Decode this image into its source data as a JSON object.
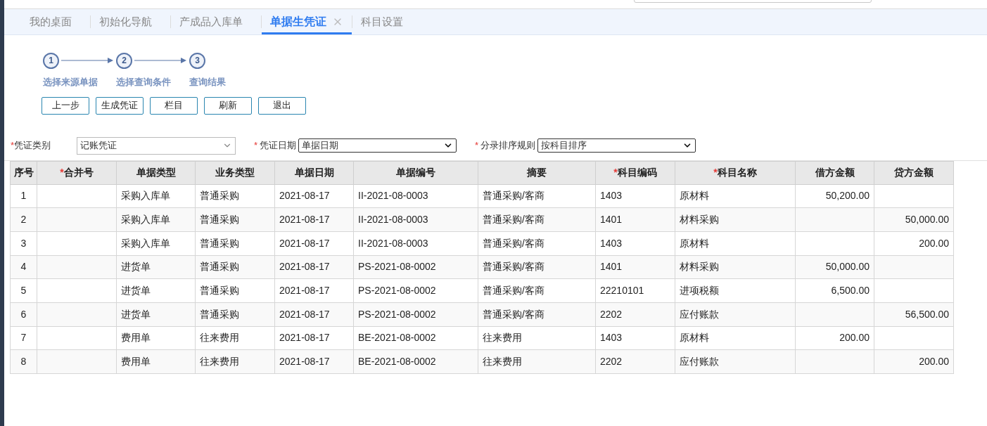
{
  "tabs": [
    {
      "label": "我的桌面",
      "selected": false
    },
    {
      "label": "初始化导航",
      "selected": false
    },
    {
      "label": "产成品入库单",
      "selected": false
    },
    {
      "label": "单据生凭证",
      "selected": true
    },
    {
      "label": "科目设置",
      "selected": false
    }
  ],
  "steps": [
    {
      "number": "1",
      "label": "选择来源单据"
    },
    {
      "number": "2",
      "label": "选择查询条件"
    },
    {
      "number": "3",
      "label": "查询结果"
    }
  ],
  "buttons": [
    "上一步",
    "生成凭证",
    "栏目",
    "刷新",
    "退出"
  ],
  "filters": [
    {
      "required_mark": "*",
      "label": "凭证类别",
      "value": "记账凭证",
      "kind": "wide"
    },
    {
      "required_mark": "*",
      "label": "凭证日期",
      "value": "单据日期",
      "kind": "narrow"
    },
    {
      "required_mark": "*",
      "label": "分录排序规则",
      "value": "按科目排序",
      "kind": "narrow"
    }
  ],
  "table": {
    "columns": [
      {
        "label": "序号",
        "kind": "index"
      },
      {
        "required_mark": "*",
        "label": "合并号",
        "kind": "text"
      },
      {
        "label": "单据类型",
        "kind": "text"
      },
      {
        "label": "业务类型",
        "kind": "text"
      },
      {
        "label": "单据日期",
        "kind": "text"
      },
      {
        "label": "单据编号",
        "kind": "text"
      },
      {
        "label": "摘要",
        "kind": "text"
      },
      {
        "required_mark": "*",
        "label": "科目编码",
        "kind": "text"
      },
      {
        "required_mark": "*",
        "label": "科目名称",
        "kind": "text"
      },
      {
        "label": "借方金额",
        "kind": "amount"
      },
      {
        "label": "贷方金额",
        "kind": "amount"
      }
    ],
    "rows": [
      [
        "1",
        "",
        "采购入库单",
        "普通采购",
        "2021-08-17",
        "II-2021-08-0003",
        "普通采购/客商",
        "1403",
        "原材料",
        "50,200.00",
        ""
      ],
      [
        "2",
        "",
        "采购入库单",
        "普通采购",
        "2021-08-17",
        "II-2021-08-0003",
        "普通采购/客商",
        "1401",
        "材料采购",
        "",
        "50,000.00"
      ],
      [
        "3",
        "",
        "采购入库单",
        "普通采购",
        "2021-08-17",
        "II-2021-08-0003",
        "普通采购/客商",
        "1403",
        "原材料",
        "",
        "200.00"
      ],
      [
        "4",
        "",
        "进货单",
        "普通采购",
        "2021-08-17",
        "PS-2021-08-0002",
        "普通采购/客商",
        "1401",
        "材料采购",
        "50,000.00",
        ""
      ],
      [
        "5",
        "",
        "进货单",
        "普通采购",
        "2021-08-17",
        "PS-2021-08-0002",
        "普通采购/客商",
        "22210101",
        "进项税额",
        "6,500.00",
        ""
      ],
      [
        "6",
        "",
        "进货单",
        "普通采购",
        "2021-08-17",
        "PS-2021-08-0002",
        "普通采购/客商",
        "2202",
        "应付账款",
        "",
        "56,500.00"
      ],
      [
        "7",
        "",
        "费用单",
        "往来费用",
        "2021-08-17",
        "BE-2021-08-0002",
        "往来费用",
        "1403",
        "原材料",
        "200.00",
        ""
      ],
      [
        "8",
        "",
        "费用单",
        "往来费用",
        "2021-08-17",
        "BE-2021-08-0002",
        "往来费用",
        "2202",
        "应付账款",
        "",
        "200.00"
      ]
    ]
  }
}
